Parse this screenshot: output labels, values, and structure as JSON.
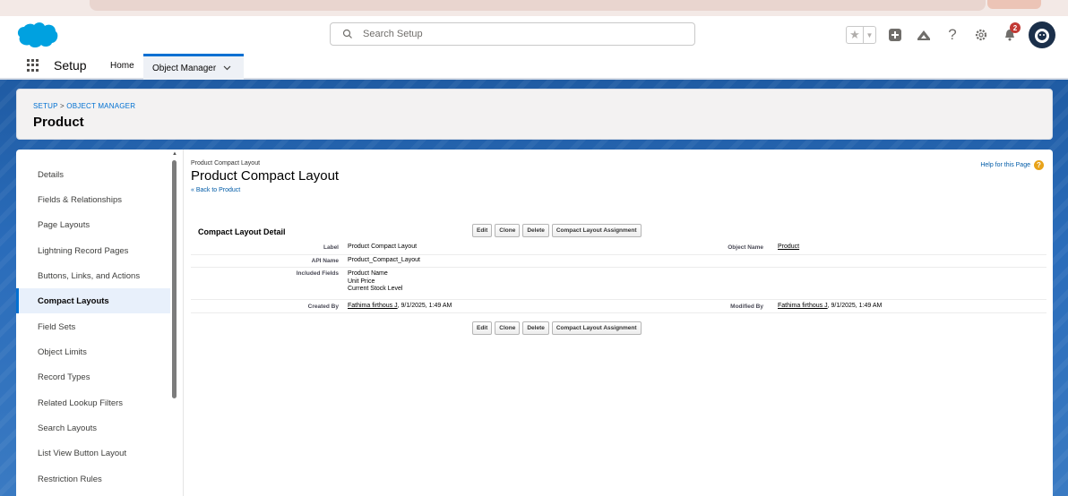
{
  "header": {
    "search_placeholder": "Search Setup",
    "notification_count": "2"
  },
  "nav": {
    "app_name": "Setup",
    "tabs": [
      {
        "label": "Home"
      },
      {
        "label": "Object Manager"
      }
    ]
  },
  "object_header": {
    "breadcrumb_setup": "SETUP",
    "breadcrumb_sep": ">",
    "breadcrumb_object_manager": "OBJECT MANAGER",
    "title": "Product"
  },
  "sidebar": {
    "items": [
      {
        "label": "Details"
      },
      {
        "label": "Fields & Relationships"
      },
      {
        "label": "Page Layouts"
      },
      {
        "label": "Lightning Record Pages"
      },
      {
        "label": "Buttons, Links, and Actions"
      },
      {
        "label": "Compact Layouts"
      },
      {
        "label": "Field Sets"
      },
      {
        "label": "Object Limits"
      },
      {
        "label": "Record Types"
      },
      {
        "label": "Related Lookup Filters"
      },
      {
        "label": "Search Layouts"
      },
      {
        "label": "List View Button Layout"
      },
      {
        "label": "Restriction Rules"
      }
    ],
    "active_index": 5
  },
  "page": {
    "type_label": "Product Compact Layout",
    "title": "Product Compact Layout",
    "back_link": "« Back to Product",
    "help_link": "Help for this Page",
    "section_title": "Compact Layout Detail",
    "buttons": {
      "edit": "Edit",
      "clone": "Clone",
      "delete": "Delete",
      "assignment": "Compact Layout Assignment"
    }
  },
  "detail": {
    "label_label": "Label",
    "label_value": "Product Compact Layout",
    "object_name_label": "Object Name",
    "object_name_value": "Product",
    "api_name_label": "API Name",
    "api_name_value": "Product_Compact_Layout",
    "included_fields_label": "Included Fields",
    "included_fields": [
      "Product Name",
      "Unit Price",
      "Current Stock Level"
    ],
    "created_by_label": "Created By",
    "created_by_user": "Fathima firthous J",
    "created_by_date": ", 9/1/2025, 1:49 AM",
    "modified_by_label": "Modified By",
    "modified_by_user": "Fathima firthous J",
    "modified_by_date": ", 9/1/2025, 1:49 AM"
  },
  "colors": {
    "brand_blue": "#0070d2",
    "banner_blue": "#2a6cba",
    "link_blue": "#015ba7"
  }
}
